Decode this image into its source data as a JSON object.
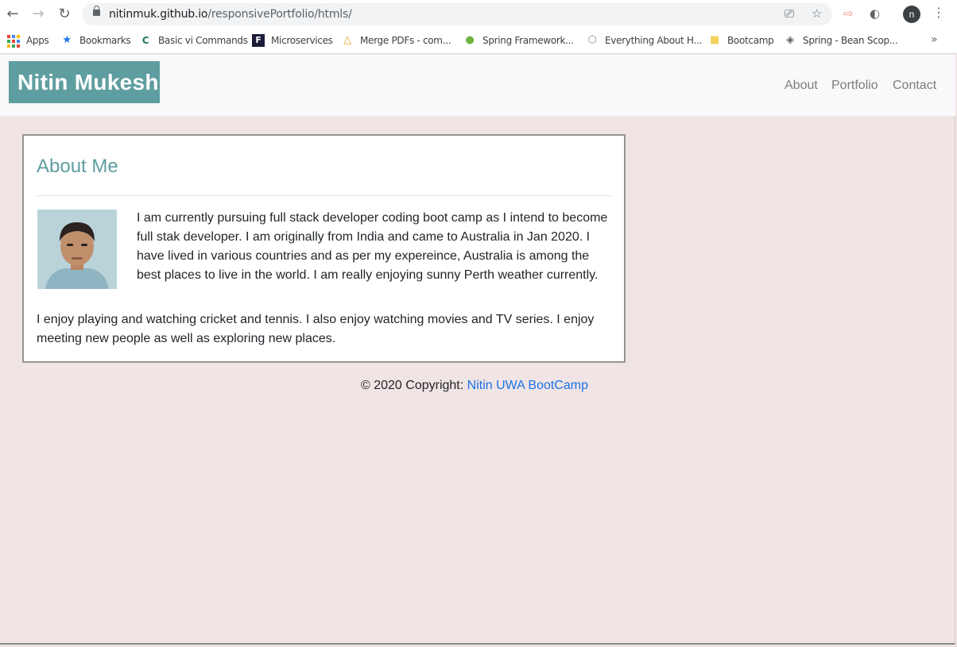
{
  "browser": {
    "url_host": "nitinmuk.github.io",
    "url_path": "/responsivePortfolio/htmls/",
    "profile_initial": "n",
    "bookmarks": [
      {
        "label": "Apps",
        "icon": "apps-grid-icon"
      },
      {
        "label": "Bookmarks",
        "icon": "star-icon"
      },
      {
        "label": "Basic vi Commands",
        "icon": "cs-logo-icon"
      },
      {
        "label": "Microservices",
        "icon": "f-logo-icon"
      },
      {
        "label": "Merge PDFs - com...",
        "icon": "warning-triangle-icon"
      },
      {
        "label": "Spring Framework...",
        "icon": "spring-leaf-icon"
      },
      {
        "label": "Everything About H...",
        "icon": "globe-icon"
      },
      {
        "label": "Bootcamp",
        "icon": "folder-icon"
      },
      {
        "label": "Spring - Bean Scop...",
        "icon": "diamond-icon"
      }
    ]
  },
  "site": {
    "brand": "Nitin Mukesh",
    "nav": [
      "About",
      "Portfolio",
      "Contact"
    ],
    "about": {
      "title": "About Me",
      "paragraph1": "I am currently pursuing full stack developer coding boot camp as I intend to become full stak developer. I am originally from India and came to Australia in Jan 2020. I have lived in various countries and as per my expereince, Australia is among the best places to live in the world. I am really enjoying sunny Perth weather currently.",
      "paragraph2": "I enjoy playing and watching cricket and tennis. I also enjoy watching movies and TV series. I enjoy meeting new people as well as exploring new places."
    },
    "footer": {
      "text": "© 2020 Copyright: ",
      "link": "Nitin UWA BootCamp"
    }
  },
  "colors": {
    "brand_bg": "#5f9ea0",
    "page_bg": "#f1e4e4",
    "link": "#1a73e8"
  }
}
